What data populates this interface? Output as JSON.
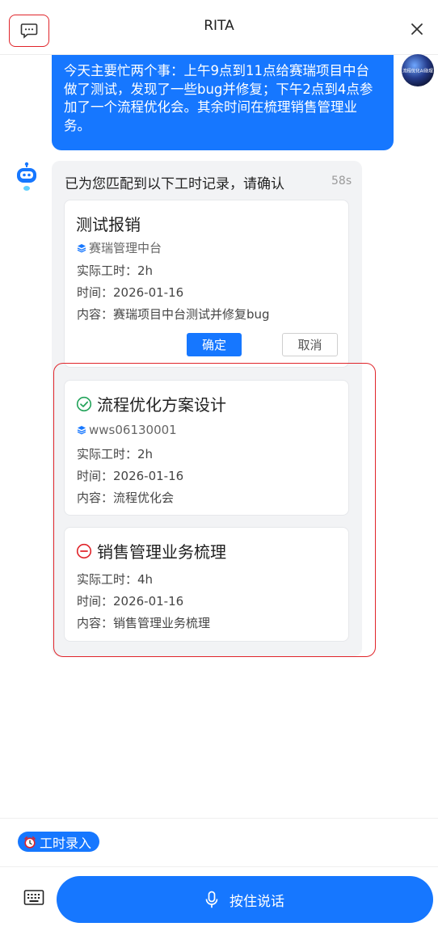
{
  "header": {
    "title": "RITA",
    "history_icon": "chat-history-icon",
    "close_icon": "close-icon"
  },
  "user_message": {
    "text": "今天主要忙两个事：上午9点到11点给赛瑞项目中台做了测试，发现了一些bug并修复；下午2点到4点参加了一个流程优化会。其余时间在梳理销售管理业务。",
    "avatar_text": "流程优化AI助理"
  },
  "bot": {
    "icon": "robot-icon",
    "header": "已为您匹配到以下工时记录，请确认",
    "elapsed": "58s",
    "cards": [
      {
        "title": "测试报销",
        "project": "赛瑞管理中台",
        "hours": "实际工时：2h",
        "date": "时间：2026-01-16",
        "content": "内容：赛瑞项目中台测试并修复bug",
        "confirm": "确定",
        "cancel": "取消"
      },
      {
        "status_icon": "check-circle-icon",
        "title": "流程优化方案设计",
        "project": "wws06130001",
        "hours": "实际工时：2h",
        "date": "时间：2026-01-16",
        "content": "内容：流程优化会"
      },
      {
        "status_icon": "minus-circle-icon",
        "title": "销售管理业务梳理",
        "hours": "实际工时：4h",
        "date": "时间：2026-01-16",
        "content": "内容：销售管理业务梳理"
      }
    ]
  },
  "footer": {
    "tag_label": "工时录入",
    "tag_icon": "alarm-clock-icon",
    "keyboard_icon": "keyboard-icon",
    "talk_label": "按住说话",
    "mic_icon": "microphone-icon"
  },
  "colors": {
    "accent": "#1677ff",
    "success": "#22a35a",
    "danger": "#e0242a"
  }
}
